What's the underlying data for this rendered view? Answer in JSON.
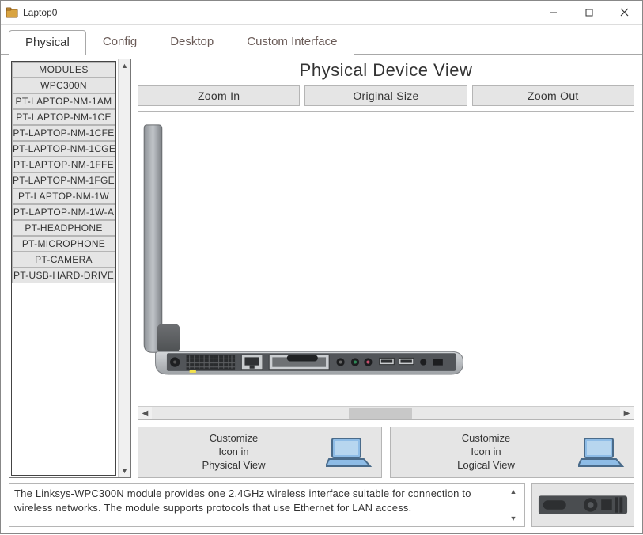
{
  "window": {
    "title": "Laptop0"
  },
  "tabs": {
    "items": [
      {
        "label": "Physical",
        "active": true
      },
      {
        "label": "Config",
        "active": false
      },
      {
        "label": "Desktop",
        "active": false
      },
      {
        "label": "Custom Interface",
        "active": false
      }
    ]
  },
  "modules": {
    "header": "MODULES",
    "items": [
      "WPC300N",
      "PT-LAPTOP-NM-1AM",
      "PT-LAPTOP-NM-1CE",
      "PT-LAPTOP-NM-1CFE",
      "PT-LAPTOP-NM-1CGE",
      "PT-LAPTOP-NM-1FFE",
      "PT-LAPTOP-NM-1FGE",
      "PT-LAPTOP-NM-1W",
      "PT-LAPTOP-NM-1W-A",
      "PT-HEADPHONE",
      "PT-MICROPHONE",
      "PT-CAMERA",
      "PT-USB-HARD-DRIVE"
    ]
  },
  "physical_view": {
    "title": "Physical Device View",
    "zoom": {
      "in": "Zoom In",
      "original": "Original Size",
      "out": "Zoom Out"
    },
    "customize_physical": "Customize\nIcon in\nPhysical View",
    "customize_logical": "Customize\nIcon in\nLogical View"
  },
  "description": "The Linksys-WPC300N module provides one 2.4GHz wireless interface suitable for connection to wireless networks. The module supports protocols that use Ethernet for LAN access.",
  "colors": {
    "panel_bg": "#e5e5e5",
    "border": "#b5b5b5"
  }
}
